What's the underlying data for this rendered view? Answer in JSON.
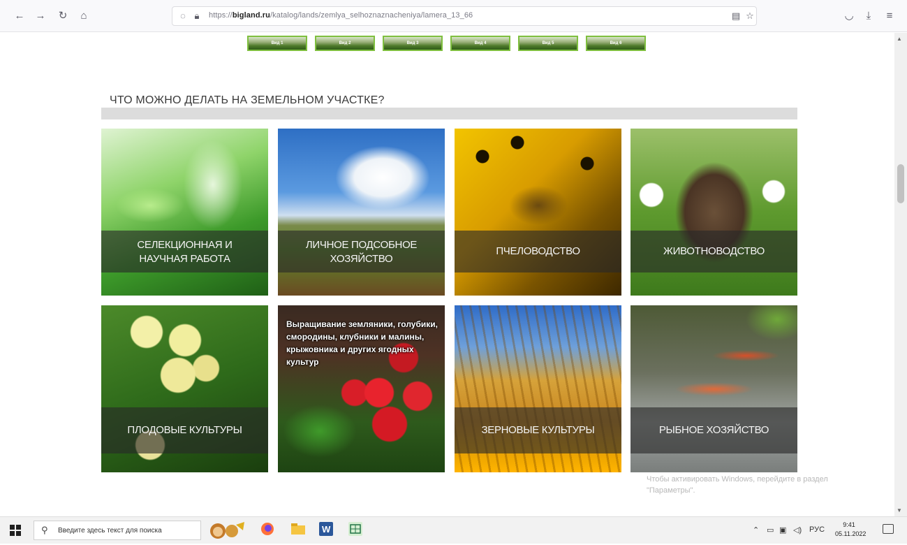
{
  "browser": {
    "back_icon": "arrow-left",
    "forward_icon": "arrow-right",
    "reload_icon": "reload",
    "home_icon": "home",
    "url_prefix": "https://",
    "url_domain": "bigland.ru",
    "url_path": "/katalog/lands/zemlya_selhoznaznacheniya/lamera_13_66"
  },
  "gallery": {
    "thumbs": [
      "Вид 1",
      "Вид 2",
      "Вид 3",
      "Вид 4",
      "Вид 5",
      "Вид 6"
    ]
  },
  "section": {
    "heading": "ЧТО МОЖНО ДЕЛАТЬ НА ЗЕМЕЛЬНОМ УЧАСТКЕ?"
  },
  "tiles": [
    {
      "caption_line1": "СЕЛЕКЦИОННАЯ И",
      "caption_line2": "НАУЧНАЯ РАБОТА"
    },
    {
      "caption_line1": "ЛИЧНОЕ ПОДСОБНОЕ",
      "caption_line2": "ХОЗЯЙСТВО"
    },
    {
      "caption_line1": "ПЧЕЛОВОДСТВО"
    },
    {
      "caption_line1": "ЖИВОТНОВОДСТВО"
    },
    {
      "caption_line1": "ПЛОДОВЫЕ КУЛЬТУРЫ"
    },
    {
      "note": "Выращивание земляники, голубики, смородины, клубники и малины, крыжовника и других ягодных культур"
    },
    {
      "caption_line1": "ЗЕРНОВЫЕ КУЛЬТУРЫ"
    },
    {
      "caption_line1": "РЫБНОЕ ХОЗЯЙСТВО"
    }
  ],
  "windows_watermark": {
    "line1": "Чтобы активировать Windows, перейдите в раздел",
    "line2": "\"Параметры\"."
  },
  "taskbar": {
    "search_placeholder": "Введите здесь текст для поиска",
    "lang": "РУС",
    "time": "9:41",
    "date": "05.11.2022"
  }
}
